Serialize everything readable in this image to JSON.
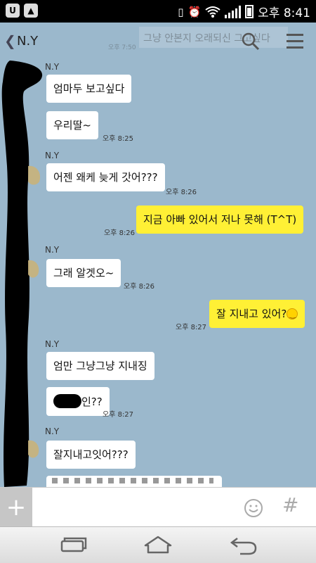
{
  "status_bar": {
    "left_icons": [
      "uplus-icon",
      "image-icon"
    ],
    "right_icons": [
      "phone-vibrate-icon",
      "alarm-icon",
      "wifi-icon",
      "signal-icon",
      "battery-icon"
    ],
    "clock": "오후 8:41"
  },
  "header": {
    "back_glyph": "❮",
    "title": "N.Y",
    "preview_text": "그냥 안본지 오래되신 그고싶다",
    "preview_time": "오후 7:50"
  },
  "chat": {
    "messages": [
      {
        "sender": "N.Y",
        "text": "엄마두 보고싶다"
      },
      {
        "text": "우리딸~",
        "time": "오후 8:25"
      },
      {
        "sender": "N.Y",
        "text": "어젠 왜케 늦게 갓어???",
        "time": "오후 8:26"
      },
      {
        "text": "지금 아빠 있어서 저나 못해 (T^T)",
        "time": "오후 8:26",
        "outgoing": true
      },
      {
        "sender": "N.Y",
        "text": "그래 알겟오~",
        "time": "오후 8:26"
      },
      {
        "text": "잘 지내고 있어?",
        "emoji": "smiley-icon",
        "time": "오후 8:27",
        "outgoing": true
      },
      {
        "sender": "N.Y",
        "text": "엄만 그냥그냥 지내징"
      },
      {
        "text": "인??",
        "time": "오후 8:27",
        "redacted_prefix": true
      },
      {
        "sender": "N.Y",
        "text": "잘지내고잇어???"
      }
    ]
  },
  "input_bar": {
    "plus_label": "+",
    "placeholder": "",
    "hash_label": "#"
  },
  "nav_bar": [
    "recent-apps-icon",
    "home-icon",
    "back-icon"
  ],
  "colors": {
    "chat_background": "#9bb8cc",
    "incoming_bubble": "#ffffff",
    "outgoing_bubble": "#fff035",
    "status_bar": "#000000"
  }
}
